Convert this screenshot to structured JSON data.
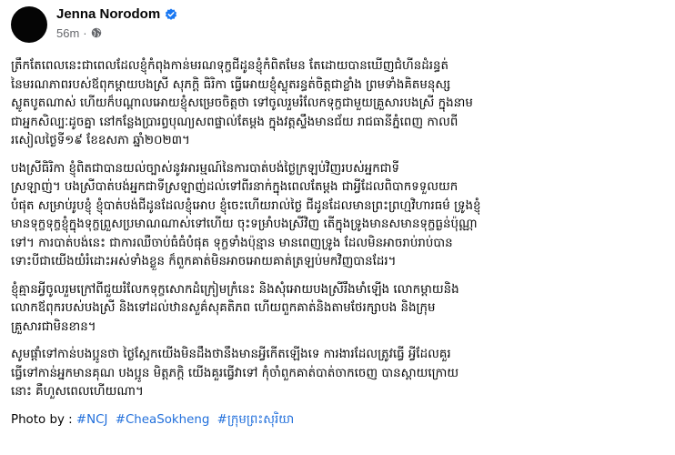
{
  "post": {
    "author": "Jenna Norodom",
    "time": "56m",
    "dot": "·",
    "paragraphs": [
      "ត្រឹកតែពេលនេះជាពេលដែលខ្ញុំកំពុងកាន់មរណទុក្ខជីដូនខ្ញុំកំពិតមែន តែដោយបានឃើញជំហីនដំរន្ធត់\nនៃមរណភាពរបស់ឪពុកម្ដាយបងស្រី សុភក្តិ ធិរិកា ធ្វើអោយខ្ញុំស្លុតរន្ធត់ចិត្តជាខ្លាំង ព្រមទាំងគិតមនុស្ស\nស្លូតបូតណាស់ ហើយក៏បណ្ដាលអោយខ្ញុំសម្រេចចិត្តថា ទៅចូលរួមរំលែកទុក្ខជាមួយគ្រួសារបងស្រី ក្នុងនាម\nជាអ្នកសិល្បៈដូចគ្នា នៅកន្លែងប្រារព្ធបុណ្យសពផ្ទាល់តែម្តង ក្នុងវត្តស្ទឹងមានជ័យ រាជធានីភ្នំពេញ កាលពី\nរសៀលថ្ងៃទី១៩ ខែឧសភា ឆ្នាំ២០២៣។",
      "បងស្រីធិរិកា ខ្ញុំពិតជាបានយល់ច្បាស់នូវអារម្មណ៍នៃការបាត់បង់ថ្ងៃក្រឡប់វិញរបស់អ្នកជាទី\nស្រឡាញ់។ បងស្រីបាត់បង់អ្នកជាទីស្រឡាញ់ដល់ទៅពីរនាក់ក្នុងពេលតែម្តង ជាអ្វីដែលពិបាកទទួលយក\nបំផុត សម្រាប់រូបខ្ញុំ ខ្ញុំបាត់បង់ជីដូនដែលខ្ញុំអោប ខ្ញុំចេះហើយរាល់ថ្ងៃ ជីដូនដែលមានព្រះព្រហ្មវិហារធម៌ ទ្រូងខ្ញុំ\nមានទុក្ខទុក្ខខ្ញុំក្នុងទុក្ខព្រួសប្រមាណណាស់ទៅហើយ ចុះទម្រាំបងស្រីវិញ តើក្នុងទ្រូងមានសមានទុក្ខធ្ងន់ប៉ុណ្ណា\nទៅ។ ការបាត់បង់នេះ ជាការឈឺចាប់ធំធំបំផុត ទុក្ខទាំងប៉ុន្មាន មានពេញទ្រូង ដែលមិនអាចរាប់រាប់បាន\nទោះបីជាយើងយំរំដោះអស់ទាំងខ្លួន ក៏ពួកគាត់មិនអាចអោយគាត់ត្រឡប់មកវិញបានដែរ។",
      "ខ្ញុំគ្មានអ្វីចូលរួមក្រៅពីជួយរំលែកទុក្ខសោកដំក្រៀមក្រំនេះ និងសុំអោយបងស្រីរឹងមាំឡើង លោកម្ដាយនិង\nលោកឪពុករបស់បងស្រី និងទៅដល់ឋានសួគ៌សុគតិភព ហើយពួកគាត់និងតាមថែរក្សាបង និងក្រុម\nគ្រួសារជាមិនខាន។",
      "សូមផ្តាំទៅកាន់បងប្អូនថា ថ្ងៃស្អែកយើងមិនដឹងថានឹងមានអ្វីកើតឡើងទេ ការងារដែលត្រូវធ្វើ អ្វីដែលគួរ\nធ្វើទៅកាន់អ្នកមានគុណ បងប្អូន មិត្តភក្តិ យើងគួរធ្វើវាទៅ កុំចាំពួកគាត់បាត់ចាកចេញ បានស្តាយក្រោយ\nនោះ គឺហួសពេលហើយណា។"
    ],
    "photo_label": "Photo by :",
    "hashtags": [
      "#NCJ",
      "#CheaSokheng",
      "#ក្រុមព្រះសុរិយា"
    ],
    "colors": {
      "hashtag": "#216fdb",
      "verified": "#1877f2",
      "meta": "#65676b"
    },
    "icons": {
      "verified": "verified-badge-icon",
      "audience": "globe-icon"
    }
  }
}
